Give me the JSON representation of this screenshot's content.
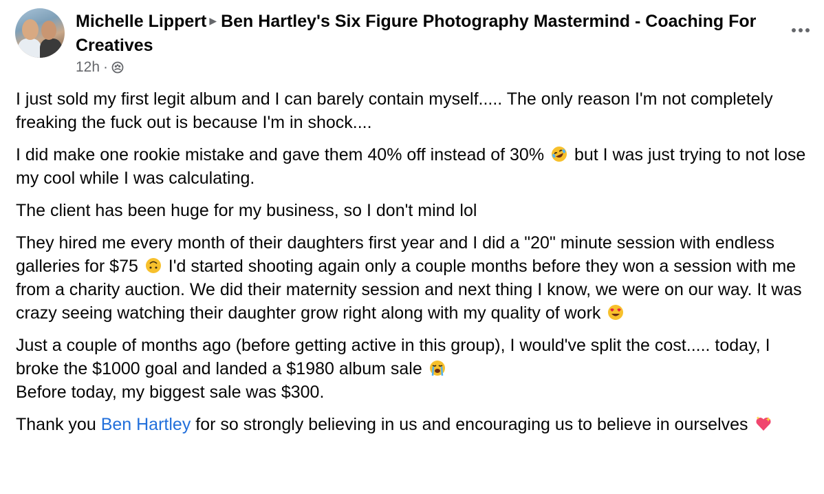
{
  "post": {
    "author": "Michelle Lippert",
    "group": "Ben Hartley's Six Figure Photography Mastermind - Coaching For Creatives",
    "time": "12h",
    "separator": "·",
    "audience_icon": "group-audience-icon",
    "more_icon": "more-options-icon"
  },
  "body": {
    "p1": "I just sold my first legit album and I can barely contain myself..... The only reason I'm not completely freaking the fuck out is because I'm in shock....",
    "p2_a": "I did make one rookie mistake and gave them 40% off instead of 30%",
    "p2_emoji": "rolling-on-floor-laughing-emoji",
    "p2_b": "but I was just trying to not lose my cool while I was calculating.",
    "p3": "The client has been huge for my business, so I don't mind lol",
    "p4_a": "They hired me every month of their daughters first year and I did a \"20\" minute session with endless galleries for $75",
    "p4_emoji1": "upside-down-face-emoji",
    "p4_b": "I'd started shooting again only a couple months before they won a session with me from a charity auction. We did their maternity session and next thing I know, we were on our way. It was crazy seeing watching their daughter grow right along with my quality of work",
    "p4_emoji2": "heart-eyes-emoji",
    "p5_a": "Just a couple of months ago (before getting active in this group), I would've split the cost..... today, I broke the $1000 goal and landed a $1980 album sale",
    "p5_emoji": "loudly-crying-emoji",
    "p5_b": "Before today, my biggest sale was $300.",
    "p6_a": "Thank you",
    "p6_mention": "Ben Hartley",
    "p6_b": "for so strongly believing in us and encouraging us to believe in ourselves",
    "p6_emoji": "sparkling-heart-emoji"
  },
  "colors": {
    "text": "#050505",
    "secondary": "#65676b",
    "link": "#216fdb"
  }
}
